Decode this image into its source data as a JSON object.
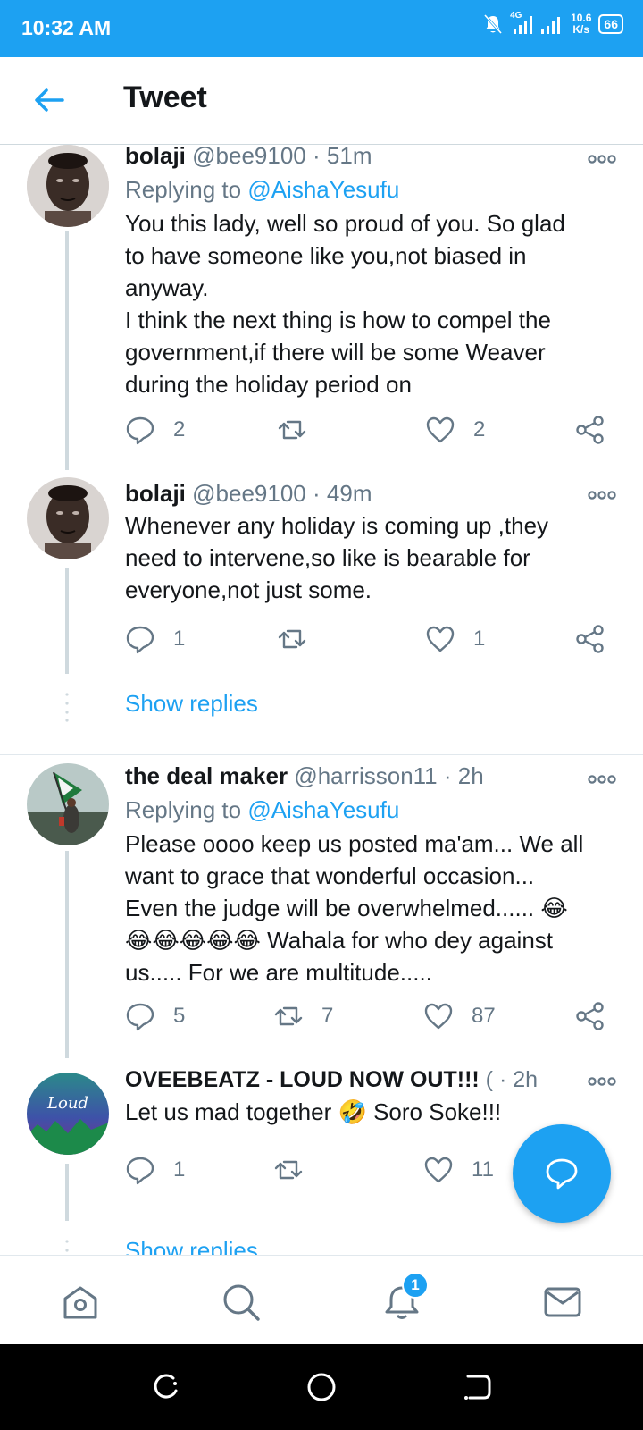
{
  "status_bar": {
    "time": "10:32 AM",
    "network_type": "4G",
    "speed_value": "10.6",
    "speed_unit": "K/s",
    "battery": "66"
  },
  "header": {
    "title": "Tweet"
  },
  "tweets": [
    {
      "name": "bolaji",
      "handle": "@bee9100",
      "time": "51m",
      "replying_label": "Replying to",
      "replying_to": "@AishaYesufu",
      "text_lines": [
        "You this lady, well so proud of you. So glad",
        "to have someone like you,not biased in",
        "anyway.",
        "I think the next thing is how to compel the",
        "government,if there will be some Weaver",
        "during the holiday period on"
      ],
      "replies": "2",
      "retweets": "",
      "likes": "2"
    },
    {
      "name": "bolaji",
      "handle": "@bee9100",
      "time": "49m",
      "text_lines": [
        "Whenever any holiday is coming up ,they",
        "need to intervene,so like is bearable for",
        "everyone,not just some."
      ],
      "replies": "1",
      "retweets": "",
      "likes": "1"
    },
    {
      "name": "the deal maker",
      "handle": "@harrisson11",
      "time": "2h",
      "replying_label": "Replying to",
      "replying_to": "@AishaYesufu",
      "text_lines": [
        "Please oooo keep us posted ma'am... We all",
        "want to grace that wonderful occasion...",
        "Even the judge will be overwhelmed...... 😂",
        "😂😂😂😂😂 Wahala for who dey against",
        "us..... For we are multitude....."
      ],
      "replies": "5",
      "retweets": "7",
      "likes": "87"
    },
    {
      "name": "OVEEBEATZ - LOUD NOW OUT!!!",
      "handle": "(",
      "time": "2h",
      "text_lines": [
        "Let us mad together 🤣 Soro Soke!!!"
      ],
      "replies": "1",
      "retweets": "",
      "likes": "11"
    }
  ],
  "show_replies_label": "Show replies",
  "avatar_text": {
    "loud": "Loud"
  },
  "separator": "·",
  "notifications_badge": "1",
  "colors": {
    "accent": "#1da1f2",
    "text": "#14171a",
    "secondary": "#657786",
    "divider": "#e1e8ed"
  },
  "icons": [
    "back-arrow-icon",
    "more-icon",
    "reply-icon",
    "retweet-icon",
    "like-icon",
    "share-icon",
    "compose-icon",
    "home-icon",
    "search-icon",
    "bell-icon",
    "mail-icon"
  ]
}
